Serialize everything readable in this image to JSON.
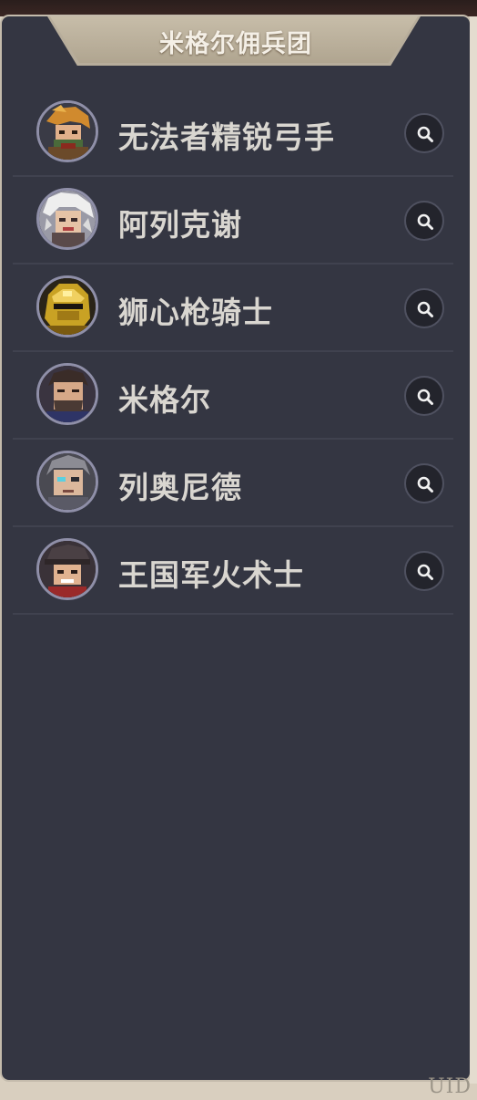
{
  "panel": {
    "title": "米格尔佣兵团"
  },
  "roster": [
    {
      "name": "无法者精锐弓手",
      "avatar_icon": "archer-portrait-icon"
    },
    {
      "name": "阿列克谢",
      "avatar_icon": "white-haired-portrait-icon"
    },
    {
      "name": "狮心枪骑士",
      "avatar_icon": "golden-helmet-portrait-icon"
    },
    {
      "name": "米格尔",
      "avatar_icon": "bearded-man-portrait-icon"
    },
    {
      "name": "列奥尼德",
      "avatar_icon": "grey-haired-portrait-icon"
    },
    {
      "name": "王国军火术士",
      "avatar_icon": "cap-soldier-portrait-icon"
    }
  ],
  "inspect_icon": "magnifier-icon",
  "footer": {
    "uid_label": "UID"
  },
  "colors": {
    "panel_bg": "#343642",
    "title_tab": "#b7ad9b",
    "name_text": "#d9d6d0",
    "divider": "#40424f"
  }
}
